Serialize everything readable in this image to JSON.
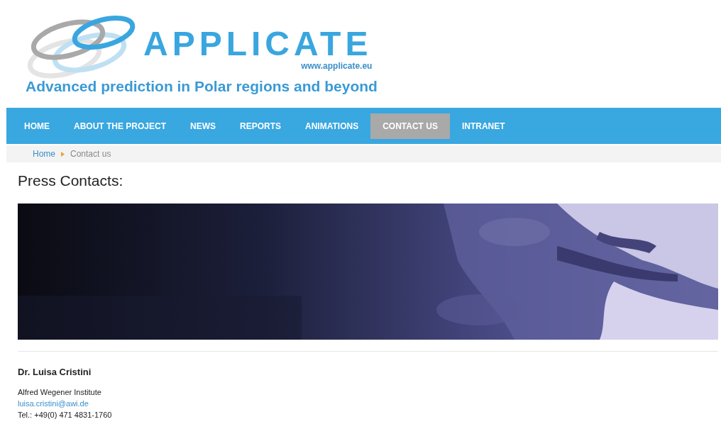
{
  "header": {
    "logo_name": "APPLICATE",
    "logo_url": "www.applicate.eu",
    "tagline": "Advanced prediction in Polar regions and beyond"
  },
  "nav": [
    {
      "label": "HOME",
      "selected": false
    },
    {
      "label": "ABOUT THE PROJECT",
      "selected": false
    },
    {
      "label": "NEWS",
      "selected": false
    },
    {
      "label": "REPORTS",
      "selected": false
    },
    {
      "label": "ANIMATIONS",
      "selected": false
    },
    {
      "label": "CONTACT US",
      "selected": true
    },
    {
      "label": "INTRANET",
      "selected": false
    }
  ],
  "breadcrumb": [
    {
      "label": "Home",
      "kind": "link"
    },
    {
      "label": "Contact us",
      "kind": "current"
    }
  ],
  "page_title": "Press Contacts:",
  "contact": {
    "name": "Dr. Luisa Cristini",
    "institute": "Alfred Wegener Institute",
    "email": "luisa.cristini@awi.de",
    "phone": "Tel.: +49(0) 471 4831-1760"
  }
}
